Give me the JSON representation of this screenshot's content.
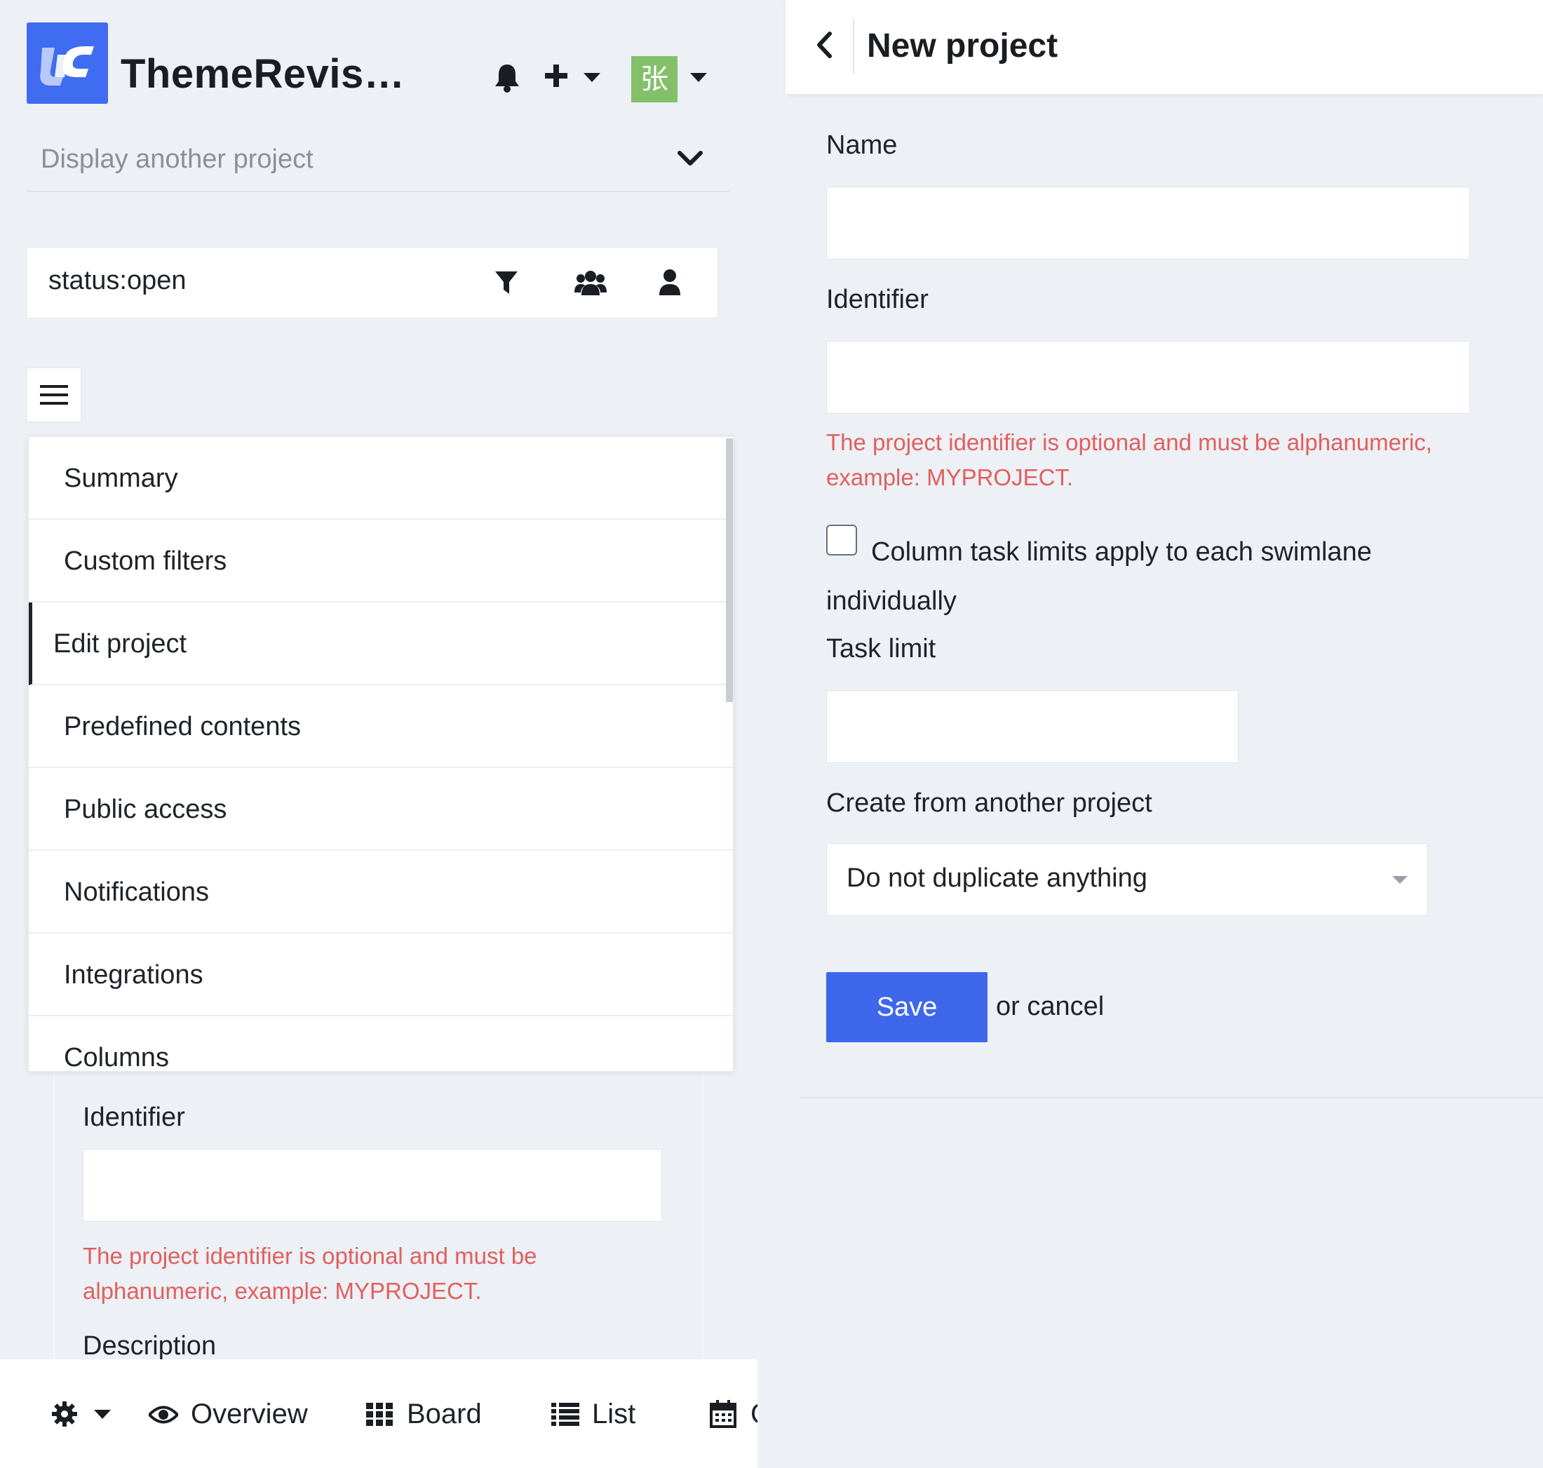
{
  "app": {
    "title": "ThemeRevis…",
    "avatar_initial": "张"
  },
  "project_selector": {
    "placeholder": "Display another project"
  },
  "filter": {
    "value": "status:open"
  },
  "menu": {
    "items": [
      {
        "label": "Summary"
      },
      {
        "label": "Custom filters"
      },
      {
        "label": "Edit project",
        "active": true
      },
      {
        "label": "Predefined contents"
      },
      {
        "label": "Public access"
      },
      {
        "label": "Notifications"
      },
      {
        "label": "Integrations"
      },
      {
        "label": "Columns"
      }
    ]
  },
  "left_form": {
    "identifier_label": "Identifier",
    "identifier_help": "The project identifier is optional and must be alphanumeric, example: MYPROJECT.",
    "description_label": "Description"
  },
  "bottom_nav": {
    "overview": "Overview",
    "board": "Board",
    "list": "List",
    "calendar_partial": "C"
  },
  "new_project": {
    "title": "New project",
    "name_label": "Name",
    "identifier_label": "Identifier",
    "identifier_help": "The project identifier is optional and must be alphanumeric, example: MYPROJECT.",
    "checkbox_label": "Column task limits apply to each swimlane individually",
    "task_limit_label": "Task limit",
    "create_from_label": "Create from another project",
    "create_from_selected": "Do not duplicate anything",
    "save_label": "Save",
    "cancel_text": "or cancel"
  },
  "colors": {
    "brand": "#3f6cf0",
    "save_button": "#3e67ec",
    "error_text": "#e0605e",
    "avatar_bg": "#84c06a",
    "page_bg": "#edf0f5"
  }
}
